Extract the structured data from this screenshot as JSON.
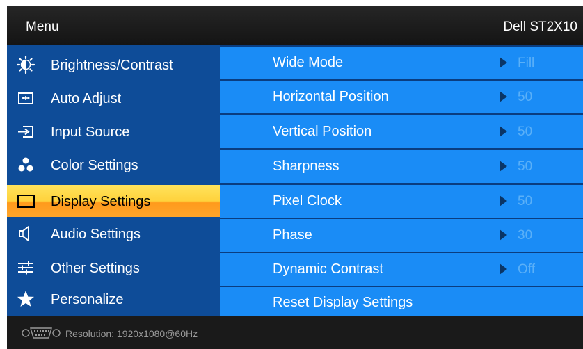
{
  "header": {
    "menu_title": "Menu",
    "model": "Dell ST2X10"
  },
  "sidebar": {
    "items": [
      {
        "label": "Brightness/Contrast",
        "icon": "brightness-icon"
      },
      {
        "label": "Auto Adjust",
        "icon": "auto-adjust-icon"
      },
      {
        "label": "Input Source",
        "icon": "input-source-icon"
      },
      {
        "label": "Color Settings",
        "icon": "color-settings-icon"
      },
      {
        "label": "Display Settings",
        "icon": "display-settings-icon",
        "selected": true
      },
      {
        "label": "Audio Settings",
        "icon": "speaker-icon"
      },
      {
        "label": "Other Settings",
        "icon": "sliders-icon"
      },
      {
        "label": "Personalize",
        "icon": "star-icon"
      }
    ]
  },
  "display_settings": {
    "rows": [
      {
        "label": "Wide Mode",
        "value": "Fill"
      },
      {
        "label": "Horizontal Position",
        "value": "50"
      },
      {
        "label": "Vertical Position",
        "value": "50"
      },
      {
        "label": "Sharpness",
        "value": "50"
      },
      {
        "label": "Pixel Clock",
        "value": "50"
      },
      {
        "label": "Phase",
        "value": "30"
      },
      {
        "label": "Dynamic Contrast",
        "value": "Off"
      },
      {
        "label": "Reset Display Settings"
      }
    ]
  },
  "footer": {
    "resolution_text": "Resolution:  1920x1080@60Hz",
    "icon": "vga-connector-icon"
  },
  "colors": {
    "sidebar_bg": "#0e4c98",
    "row_bg": "#1a8cf6",
    "selected_bg": "#ffd23c",
    "value_text": "#5ab0f8",
    "header_bg": "#1b1b1b"
  }
}
